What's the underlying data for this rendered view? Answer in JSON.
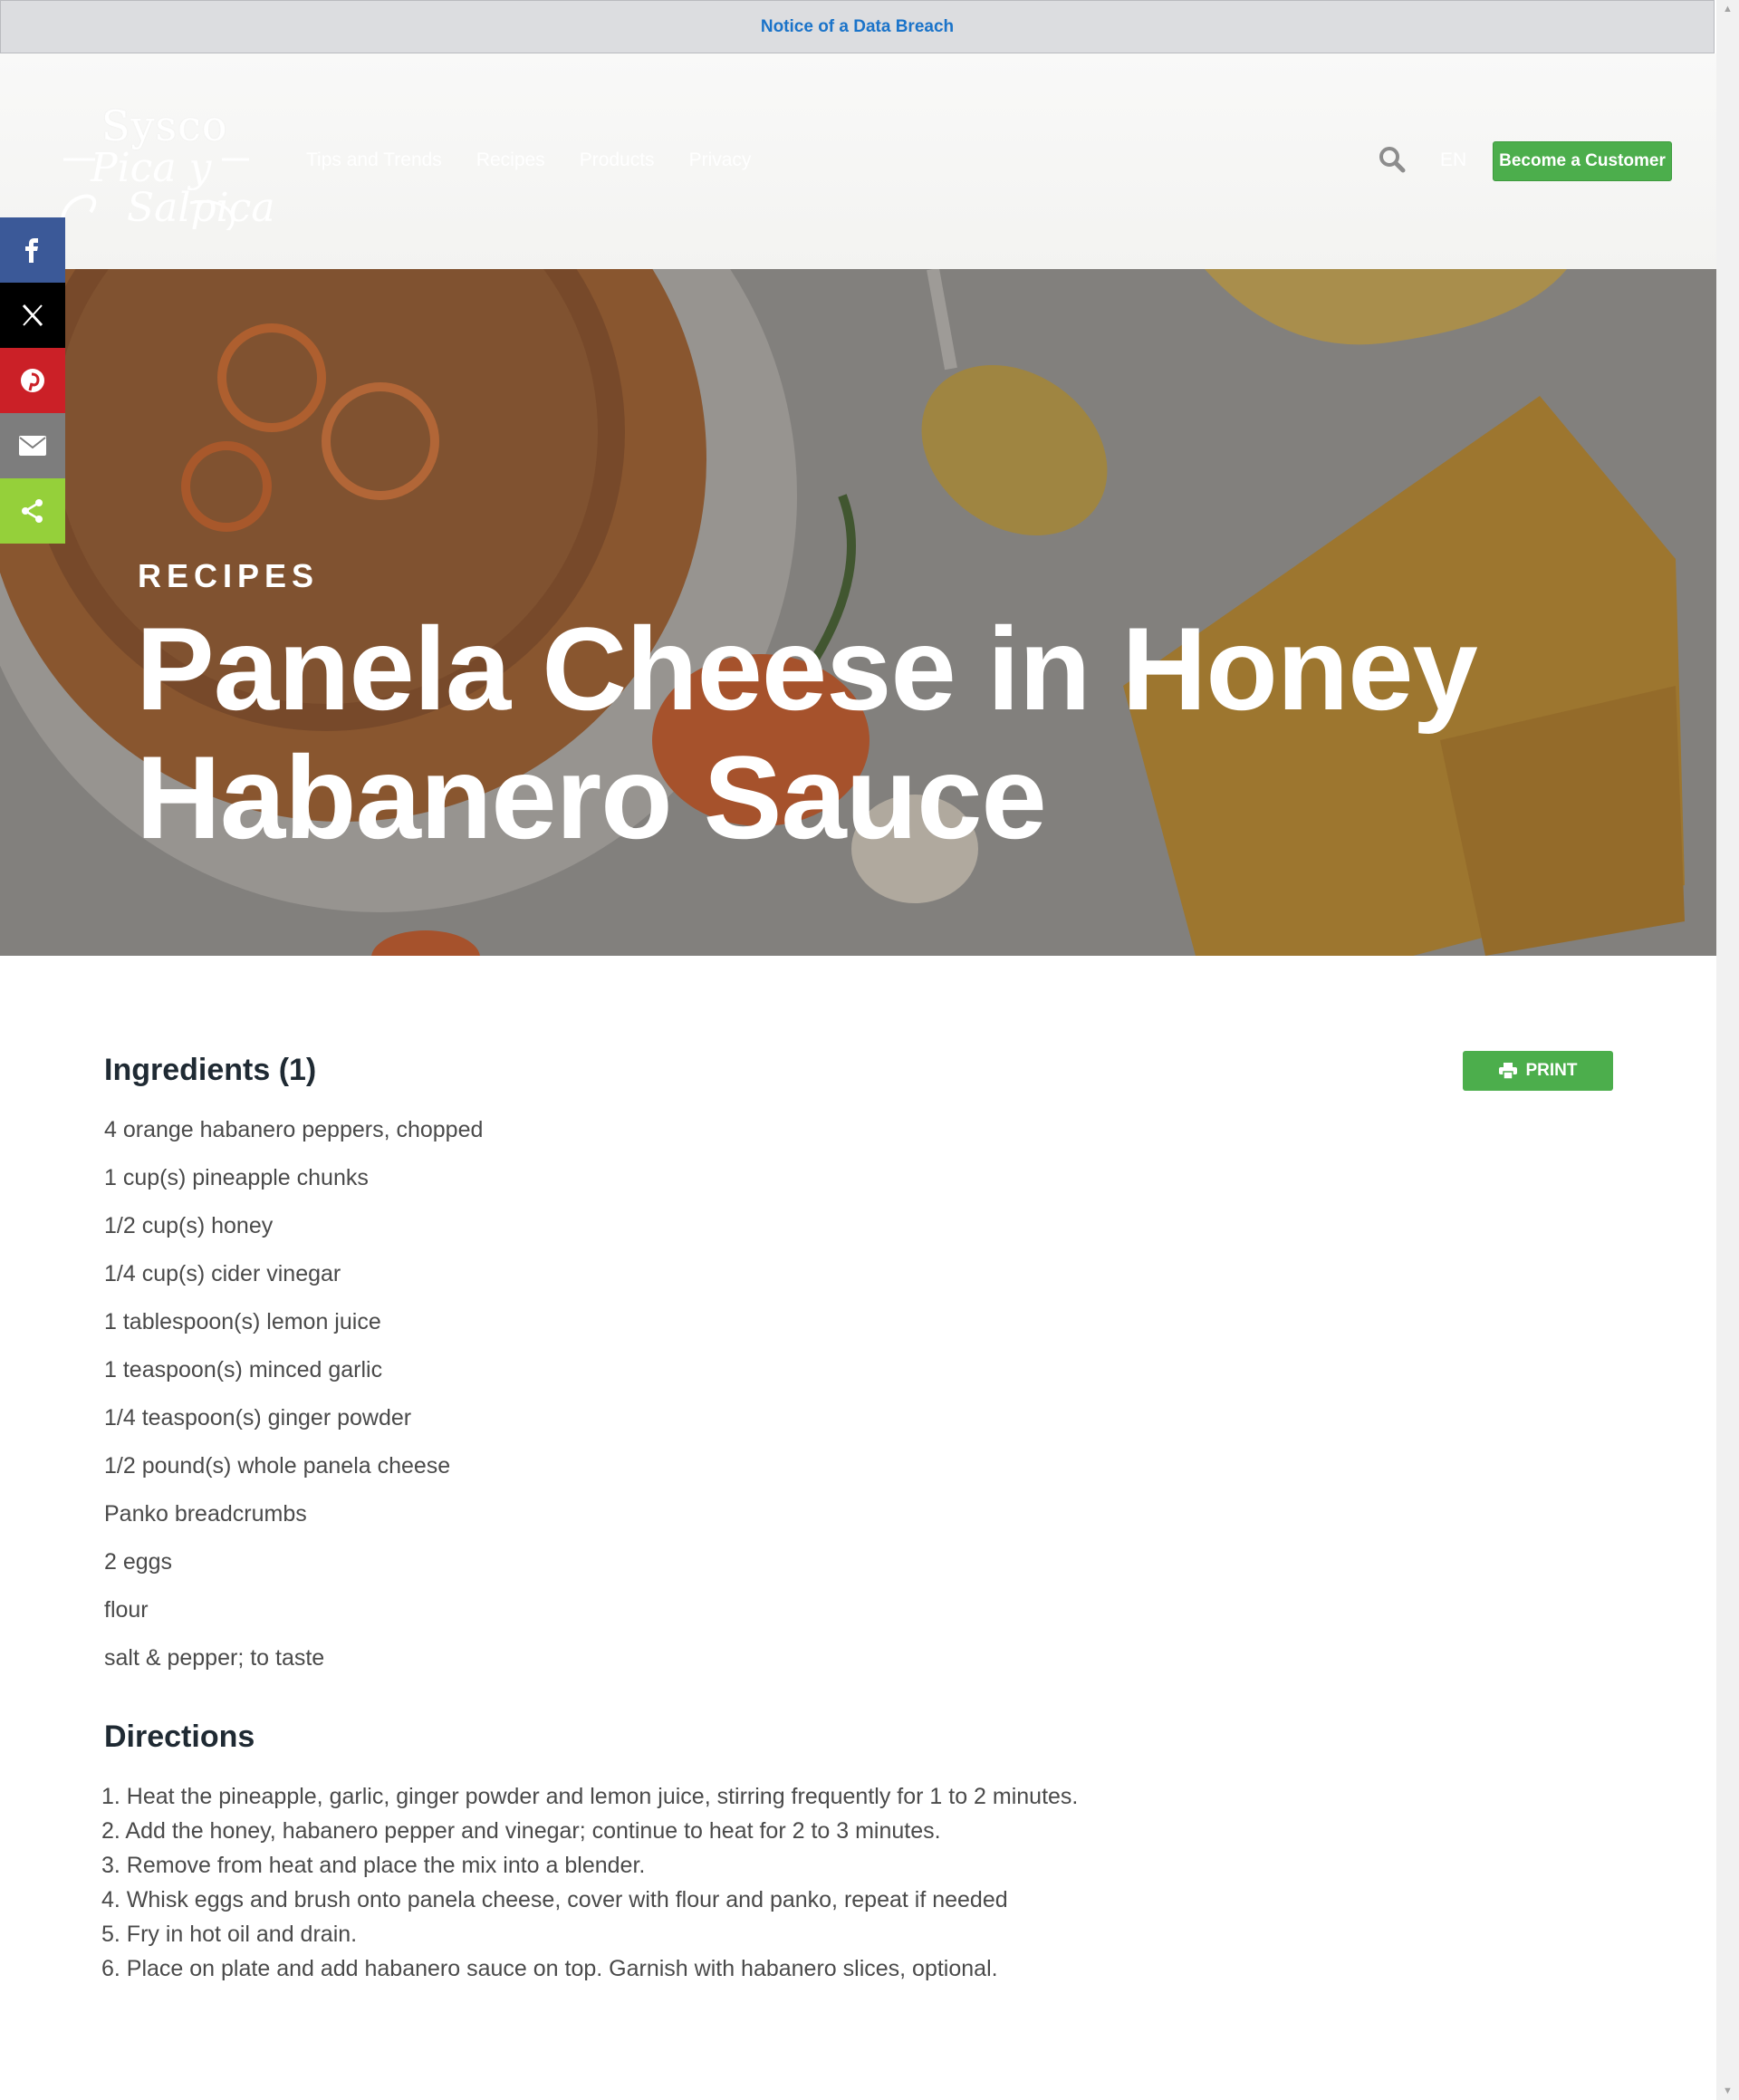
{
  "notice": {
    "text": "Notice of a Data Breach"
  },
  "header": {
    "logo": {
      "brand": "Sysco",
      "script_line1": "Pica y",
      "script_line2": "Salpica"
    },
    "nav": [
      "Tips and Trends",
      "Recipes",
      "Products",
      "Privacy"
    ],
    "search_icon": "search-icon",
    "language": "EN",
    "become_customer": "Become a Customer"
  },
  "share": [
    {
      "name": "facebook-icon",
      "color": "#3b5998"
    },
    {
      "name": "x-icon",
      "color": "#000000"
    },
    {
      "name": "pinterest-icon",
      "color": "#cb2027"
    },
    {
      "name": "email-icon",
      "color": "#7d7d7d"
    },
    {
      "name": "share-icon",
      "color": "#95d03a"
    }
  ],
  "hero": {
    "kicker": "RECIPES",
    "title": "Panela Cheese in Honey Habanero Sauce"
  },
  "ingredients": {
    "title": "Ingredients (1)",
    "print_label": "PRINT",
    "items": [
      "4 orange habanero peppers, chopped",
      "1 cup(s) pineapple chunks",
      "1/2 cup(s) honey",
      "1/4 cup(s) cider vinegar",
      "1 tablespoon(s) lemon juice",
      "1 teaspoon(s) minced garlic",
      "1/4 teaspoon(s) ginger powder",
      "1/2 pound(s) whole panela cheese",
      "Panko breadcrumbs",
      "2 eggs",
      "flour",
      "salt & pepper; to taste"
    ]
  },
  "directions": {
    "title": "Directions",
    "steps": [
      "1. Heat the pineapple, garlic, ginger powder and lemon juice, stirring frequently for 1 to 2 minutes.",
      "2. Add the honey, habanero pepper and vinegar; continue to heat for 2 to 3 minutes.",
      "3. Remove from heat and place the mix into a blender.",
      "4. Whisk eggs and brush onto panela cheese, cover with flour and panko, repeat if needed",
      "5. Fry in hot oil and drain.",
      "6. Place on plate and add habanero sauce on top. Garnish with habanero slices, optional."
    ]
  },
  "colors": {
    "accent_green": "#4cae4c",
    "link_blue": "#1a73c9"
  }
}
